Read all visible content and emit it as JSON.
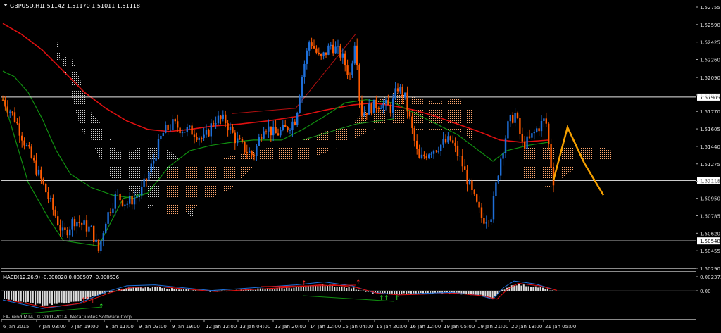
{
  "main": {
    "symbol_label": "GBPUSD,H1",
    "ohlc": "1.51142 1.51170 1.51011 1.51118",
    "price_ticks": [
      "1.52755",
      "1.52590",
      "1.52425",
      "1.52260",
      "1.52090",
      "1.51925",
      "1.51770",
      "1.51605",
      "1.51440",
      "1.51275",
      "1.51110",
      "1.50950",
      "1.50785",
      "1.50620",
      "1.50455",
      "1.50290"
    ],
    "price_range": [
      1.5029,
      1.52755
    ],
    "horizontal_lines": [
      {
        "price": 1.51905,
        "label": "1.51905"
      },
      {
        "price": 1.51118,
        "label": "1.51118"
      },
      {
        "price": 1.50548,
        "label": "1.50548"
      }
    ],
    "current_price": "1.51118"
  },
  "macd": {
    "label": "MACD(12,26,9) -0.000028 0.000507 -0.000536",
    "ticks": [
      "0.002373",
      "0.00"
    ],
    "value_range": [
      -0.0045,
      0.0028
    ]
  },
  "time_axis": {
    "labels": [
      "6 Jan 2015",
      "7 Jan 03:00",
      "7 Jan 19:00",
      "8 Jan 11:00",
      "9 Jan 03:00",
      "9 Jan 19:00",
      "12 Jan 12:00",
      "13 Jan 04:00",
      "13 Jan 20:00",
      "14 Jan 12:00",
      "15 Jan 04:00",
      "15 Jan 20:00",
      "16 Jan 12:00",
      "19 Jan 05:00",
      "19 Jan 21:00",
      "20 Jan 13:00",
      "21 Jan 05:00"
    ]
  },
  "watermark": "FX-Trend MT4, © 2001-2014, MetaQuotes Software Corp.",
  "colors": {
    "background": "#000000",
    "bull": "#1e6fd9",
    "bear": "#ff5a00",
    "ma_red": "#e01010",
    "ma_green": "#109010",
    "ichimoku_a": "#cfcfcf",
    "ichimoku_b": "#ffa06a",
    "forecast": "#f5a000",
    "text": "#dddddd"
  }
}
